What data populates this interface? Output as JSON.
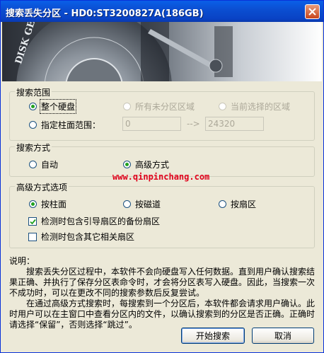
{
  "window": {
    "title": "搜索丢失分区 - HD0:ST3200827A(186GB)"
  },
  "banner": {
    "logo_text": "DISK GENIUS"
  },
  "search_range": {
    "legend": "搜索范围",
    "whole_disk_label": "整个硬盘",
    "unpartitioned_label": "所有未分区区域",
    "current_selected_label": "当前选择的区域",
    "cylinder_range_label": "指定柱面范围：",
    "cylinder_from": "0",
    "arrow": "-->",
    "cylinder_to": "24320"
  },
  "search_mode": {
    "legend": "搜索方式",
    "auto_label": "自动",
    "advanced_label": "高级方式"
  },
  "watermark": "www.qinpinchang.com",
  "advanced_options": {
    "legend": "高级方式选项",
    "by_cylinder_label": "按柱面",
    "by_track_label": "按磁道",
    "by_sector_label": "按扇区",
    "check_backup_boot_label": "检测时包含引导扇区的备份扇区",
    "check_backup_boot_checked": true,
    "check_other_label": "检测时包含其它相关扇区",
    "check_other_checked": false
  },
  "description": {
    "heading": "说明：",
    "lines": [
      "　　搜索丢失分区过程中，本软件不会向硬盘写入任何数据。直到用户确认搜索结",
      "果正确、并执行了保存分区表命令时，才会将分区表写入硬盘。因此，当搜索一次",
      "不成功时，可以在更改不同的搜索参数后反复尝试。",
      "　　在通过高级方式搜索时，每搜索到一个分区后，本软件都会请求用户确认。此",
      "时用户可以在主窗口中查看分区内的文件，以确认搜索到的分区是否正确。正确时",
      "请选择“保留”，否则选择“跳过”。"
    ]
  },
  "buttons": {
    "start_label": "开始搜索",
    "cancel_label": "取消"
  },
  "colors": {
    "titlebar": "#0a5fe8",
    "watermark": "#e0001b",
    "radio_dot": "#21a121"
  }
}
